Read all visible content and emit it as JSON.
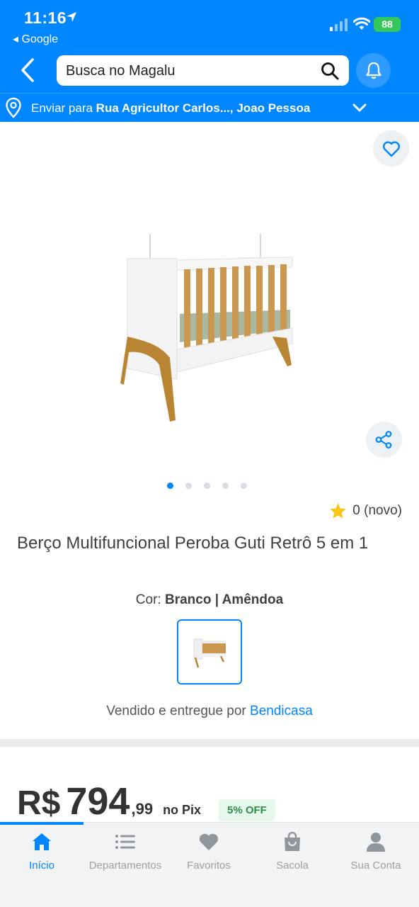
{
  "status_bar": {
    "time": "11:16",
    "back_app": "◂ Google",
    "battery": "88"
  },
  "header": {
    "search_placeholder": "Busca no Magalu",
    "delivery_prefix": "Enviar para ",
    "delivery_address": "Rua Agricultor Carlos..., Joao Pessoa"
  },
  "product": {
    "image_count": 5,
    "active_image": 1,
    "rating_text": "0 (novo)",
    "title": "Berço Multifuncional Peroba Guti Retrô 5 em 1",
    "color_label": "Cor: ",
    "color_value": "Branco | Amêndoa",
    "seller_prefix": "Vendido e entregue por ",
    "seller_name": "Bendicasa"
  },
  "price": {
    "currency": "R$",
    "integer": "794",
    "cents": ",99",
    "method": "no Pix",
    "discount": "5% OFF"
  },
  "bottom_nav": {
    "items": [
      {
        "label": "Início",
        "icon": "home-icon",
        "active": true
      },
      {
        "label": "Departamentos",
        "icon": "list-icon",
        "active": false
      },
      {
        "label": "Favoritos",
        "icon": "heart-icon",
        "active": false
      },
      {
        "label": "Sacola",
        "icon": "bag-icon",
        "active": false
      },
      {
        "label": "Sua Conta",
        "icon": "user-icon",
        "active": false
      }
    ]
  },
  "colors": {
    "brand_blue": "#0086ff",
    "discount_green": "#2e8a4d",
    "star_yellow": "#f5c518"
  }
}
